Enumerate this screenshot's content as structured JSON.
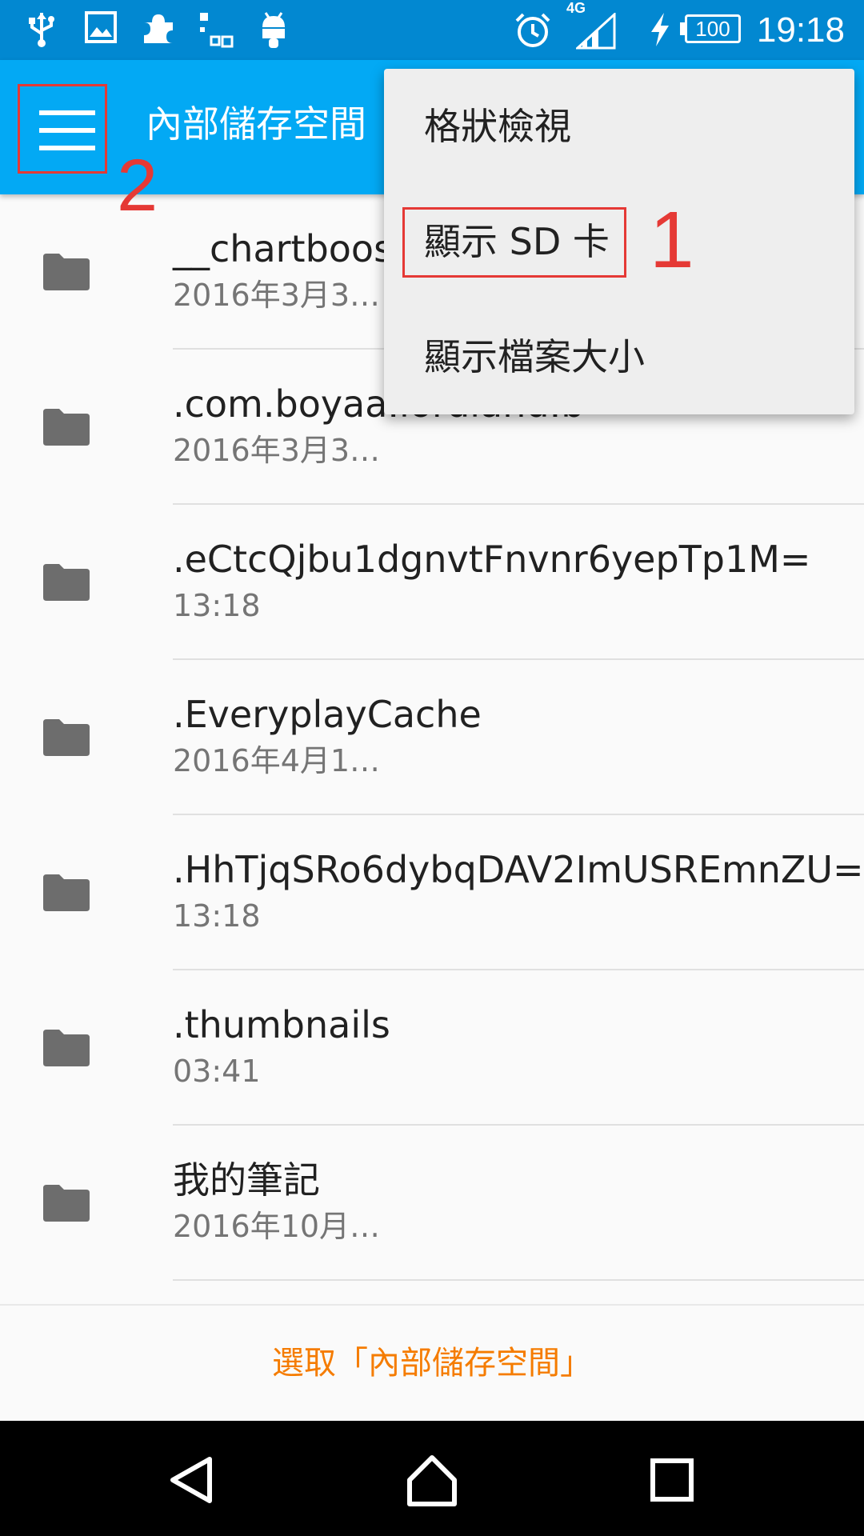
{
  "status_bar": {
    "time": "19:18",
    "battery": "100",
    "network": "4G",
    "icons": [
      "usb-icon",
      "image-icon",
      "puzzle-icon",
      "share-icon",
      "android-icon",
      "alarm-icon",
      "signal-icon",
      "charging-icon"
    ]
  },
  "app_bar": {
    "title": "內部儲存空間",
    "menu_icon": "hamburger-icon"
  },
  "files": [
    {
      "name": "__chartboost",
      "date": "2016年3月3…"
    },
    {
      "name": ".com.boyaa.lordland.b",
      "date": "2016年3月3…"
    },
    {
      "name": ".eCtcQjbu1dgnvtFnvnr6yepTp1M=",
      "date": "13:18"
    },
    {
      "name": ".EveryplayCache",
      "date": "2016年4月1…"
    },
    {
      "name": ".HhTjqSRo6dybqDAV2ImUSREmnZU=",
      "date": "13:18"
    },
    {
      "name": ".thumbnails",
      "date": "03:41"
    },
    {
      "name": "我的筆記",
      "date": "2016年10月…"
    }
  ],
  "popup_menu": {
    "items": [
      "格狀檢視",
      "顯示 SD 卡",
      "顯示檔案大小"
    ]
  },
  "annotations": {
    "one": "1",
    "two": "2",
    "color": "#e53935"
  },
  "select_bar": {
    "label": "選取「內部儲存空間」"
  },
  "colors": {
    "status_bar": "#0288d1",
    "app_bar": "#03a9f4",
    "accent": "#f57c00"
  }
}
